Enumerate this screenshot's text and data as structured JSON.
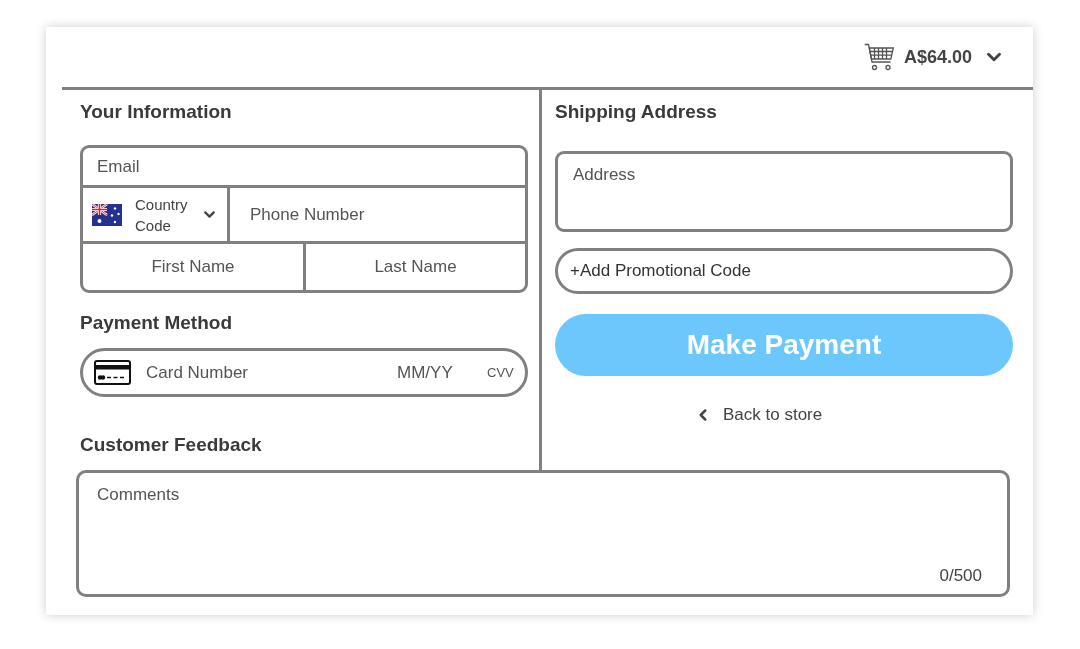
{
  "header": {
    "order_total": "A$64.00"
  },
  "your_information": {
    "title": "Your Information",
    "email": {
      "placeholder": "Email"
    },
    "country_code": {
      "label": "Country Code"
    },
    "phone": {
      "placeholder": "Phone Number"
    },
    "first_name": {
      "placeholder": "First Name"
    },
    "last_name": {
      "placeholder": "Last Name"
    }
  },
  "payment_method": {
    "title": "Payment Method",
    "card_number": {
      "placeholder": "Card Number"
    },
    "expiry": {
      "placeholder": "MM/YY"
    },
    "cvv": {
      "placeholder": "CVV"
    }
  },
  "customer_feedback": {
    "title": "Customer Feedback",
    "comments": {
      "placeholder": "Comments"
    },
    "counter": "0/500"
  },
  "shipping_address": {
    "title": "Shipping Address",
    "address": {
      "placeholder": "Address"
    },
    "promo_button": "+Add Promotional Code",
    "pay_button": "Make Payment",
    "back_link": "Back to store"
  }
}
